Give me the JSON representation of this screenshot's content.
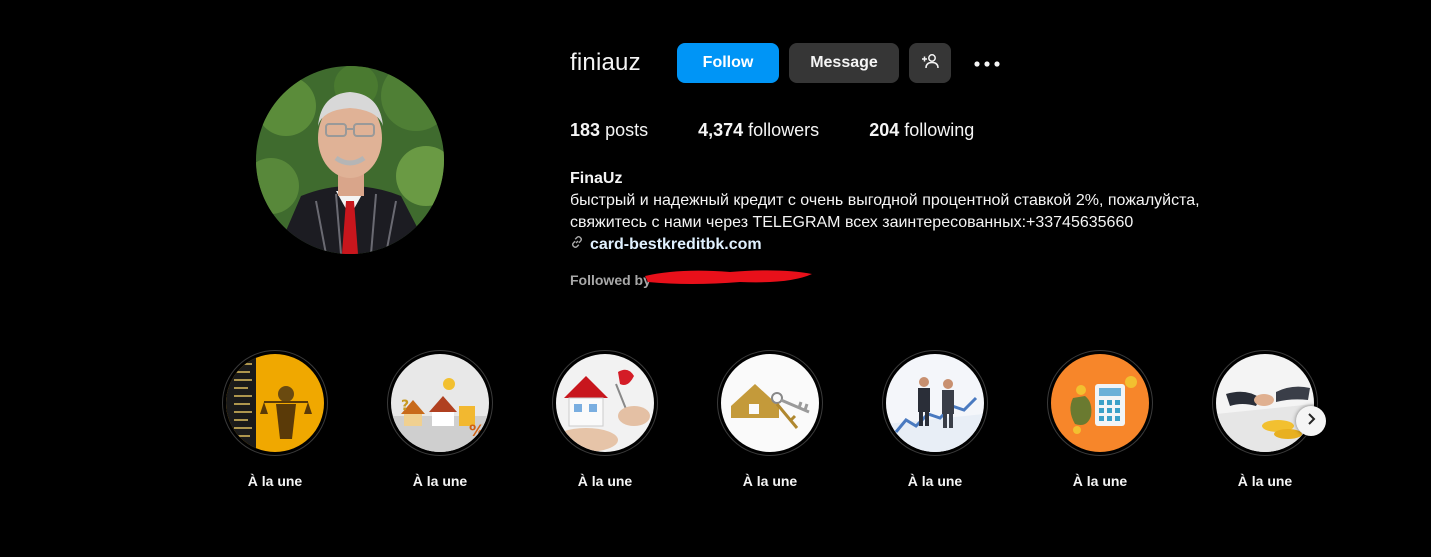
{
  "profile": {
    "username": "finiauz",
    "full_name": "FinaUz",
    "bio": "быстрый и надежный кредит с очень выгодной процентной ставкой 2%, пожалуйста,\nсвяжитесь с нами через TELEGRAM всех заинтересованных:+33745635660",
    "link": "card-bestkreditbk.com",
    "followed_by": "Followed by"
  },
  "actions": {
    "follow_label": "Follow",
    "message_label": "Message",
    "suggest_icon": "add-person-icon",
    "more_icon": "more-options-icon"
  },
  "stats": {
    "posts_count": "183",
    "posts_label": "posts",
    "followers_count": "4,374",
    "followers_label": "followers",
    "following_count": "204",
    "following_label": "following"
  },
  "highlights": [
    {
      "label": "À la une",
      "theme": "justice"
    },
    {
      "label": "À la une",
      "theme": "houses-percent"
    },
    {
      "label": "À la une",
      "theme": "house-key"
    },
    {
      "label": "À la une",
      "theme": "keys"
    },
    {
      "label": "À la une",
      "theme": "businessmen"
    },
    {
      "label": "À la une",
      "theme": "calculator"
    },
    {
      "label": "À la une",
      "theme": "handshake"
    }
  ],
  "colors": {
    "accent": "#0095f6",
    "button_secondary": "#363636",
    "redaction": "#e8101a"
  }
}
